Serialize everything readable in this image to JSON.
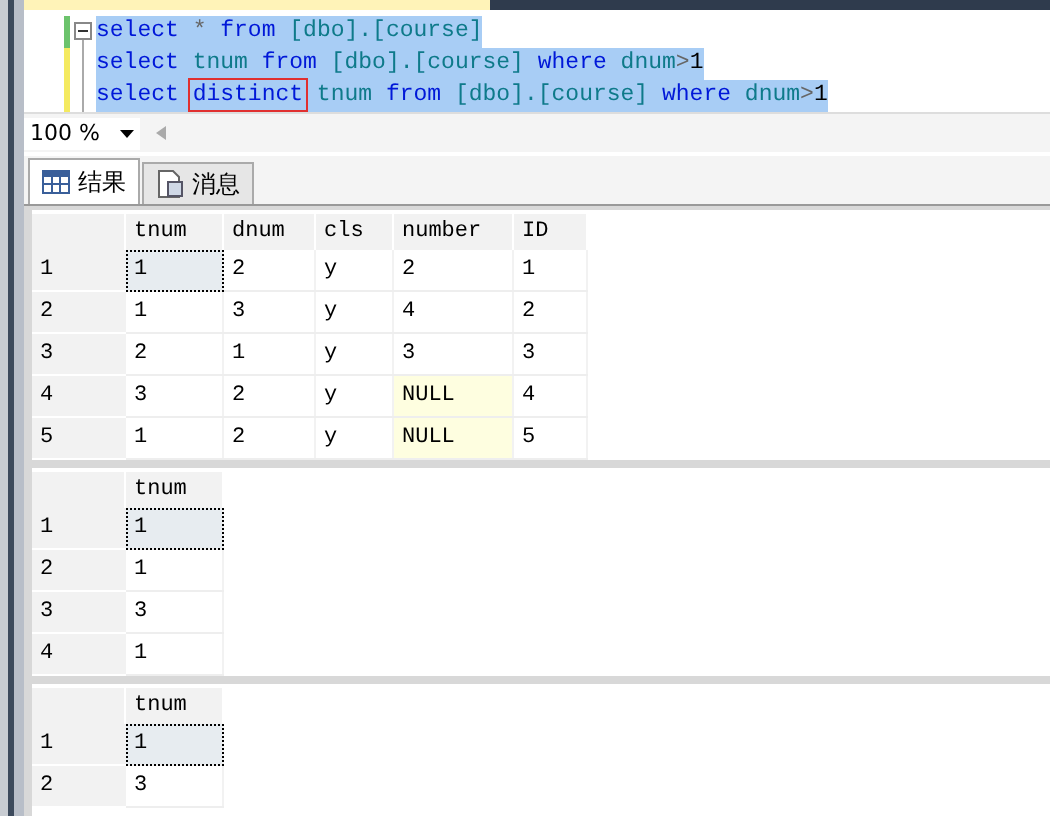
{
  "editor": {
    "lines": [
      [
        {
          "text": "select ",
          "kind": "keyword"
        },
        {
          "text": "* ",
          "kind": "operator"
        },
        {
          "text": "from ",
          "kind": "keyword"
        },
        {
          "text": "[dbo].[course]",
          "kind": "identifier"
        }
      ],
      [
        {
          "text": "select ",
          "kind": "keyword"
        },
        {
          "text": "tnum ",
          "kind": "identifier"
        },
        {
          "text": "from ",
          "kind": "keyword"
        },
        {
          "text": "[dbo].[course] ",
          "kind": "identifier"
        },
        {
          "text": "where ",
          "kind": "keyword"
        },
        {
          "text": "dnum",
          "kind": "identifier"
        },
        {
          "text": ">",
          "kind": "operator"
        },
        {
          "text": "1",
          "kind": "plain"
        }
      ],
      [
        {
          "text": "select ",
          "kind": "keyword"
        },
        {
          "text": "distinct",
          "kind": "boxed"
        },
        {
          "text": " tnum ",
          "kind": "identifier"
        },
        {
          "text": "from ",
          "kind": "keyword"
        },
        {
          "text": "[dbo].[course] ",
          "kind": "identifier"
        },
        {
          "text": "where ",
          "kind": "keyword"
        },
        {
          "text": "dnum",
          "kind": "identifier"
        },
        {
          "text": ">",
          "kind": "operator"
        },
        {
          "text": "1",
          "kind": "plain"
        }
      ]
    ]
  },
  "zoom": {
    "value": "100 %"
  },
  "tabs": [
    {
      "label": "结果",
      "kind": "grid",
      "selected": true
    },
    {
      "label": "消息",
      "kind": "document",
      "selected": false
    }
  ],
  "grids": [
    {
      "columns": [
        "tnum",
        "dnum",
        "cls",
        "number",
        "ID"
      ],
      "rows": [
        {
          "num": "1",
          "cells": [
            {
              "text": "1",
              "kind": "value",
              "focused": true
            },
            {
              "text": "2",
              "kind": "value",
              "focused": false
            },
            {
              "text": "y",
              "kind": "value",
              "focused": false
            },
            {
              "text": "2",
              "kind": "value",
              "focused": false
            },
            {
              "text": "1",
              "kind": "value",
              "focused": false
            }
          ]
        },
        {
          "num": "2",
          "cells": [
            {
              "text": "1",
              "kind": "value",
              "focused": false
            },
            {
              "text": "3",
              "kind": "value",
              "focused": false
            },
            {
              "text": "y",
              "kind": "value",
              "focused": false
            },
            {
              "text": "4",
              "kind": "value",
              "focused": false
            },
            {
              "text": "2",
              "kind": "value",
              "focused": false
            }
          ]
        },
        {
          "num": "3",
          "cells": [
            {
              "text": "2",
              "kind": "value",
              "focused": false
            },
            {
              "text": "1",
              "kind": "value",
              "focused": false
            },
            {
              "text": "y",
              "kind": "value",
              "focused": false
            },
            {
              "text": "3",
              "kind": "value",
              "focused": false
            },
            {
              "text": "3",
              "kind": "value",
              "focused": false
            }
          ]
        },
        {
          "num": "4",
          "cells": [
            {
              "text": "3",
              "kind": "value",
              "focused": false
            },
            {
              "text": "2",
              "kind": "value",
              "focused": false
            },
            {
              "text": "y",
              "kind": "value",
              "focused": false
            },
            {
              "text": "NULL",
              "kind": "null",
              "focused": false
            },
            {
              "text": "4",
              "kind": "value",
              "focused": false
            }
          ]
        },
        {
          "num": "5",
          "cells": [
            {
              "text": "1",
              "kind": "value",
              "focused": false
            },
            {
              "text": "2",
              "kind": "value",
              "focused": false
            },
            {
              "text": "y",
              "kind": "value",
              "focused": false
            },
            {
              "text": "NULL",
              "kind": "null",
              "focused": false
            },
            {
              "text": "5",
              "kind": "value",
              "focused": false
            }
          ]
        }
      ]
    },
    {
      "columns": [
        "tnum"
      ],
      "rows": [
        {
          "num": "1",
          "cells": [
            {
              "text": "1",
              "kind": "value",
              "focused": true
            }
          ]
        },
        {
          "num": "2",
          "cells": [
            {
              "text": "1",
              "kind": "value",
              "focused": false
            }
          ]
        },
        {
          "num": "3",
          "cells": [
            {
              "text": "3",
              "kind": "value",
              "focused": false
            }
          ]
        },
        {
          "num": "4",
          "cells": [
            {
              "text": "1",
              "kind": "value",
              "focused": false
            }
          ]
        }
      ]
    },
    {
      "columns": [
        "tnum"
      ],
      "rows": [
        {
          "num": "1",
          "cells": [
            {
              "text": "1",
              "kind": "value",
              "focused": true
            }
          ]
        },
        {
          "num": "2",
          "cells": [
            {
              "text": "3",
              "kind": "value",
              "focused": false
            }
          ]
        }
      ]
    }
  ]
}
